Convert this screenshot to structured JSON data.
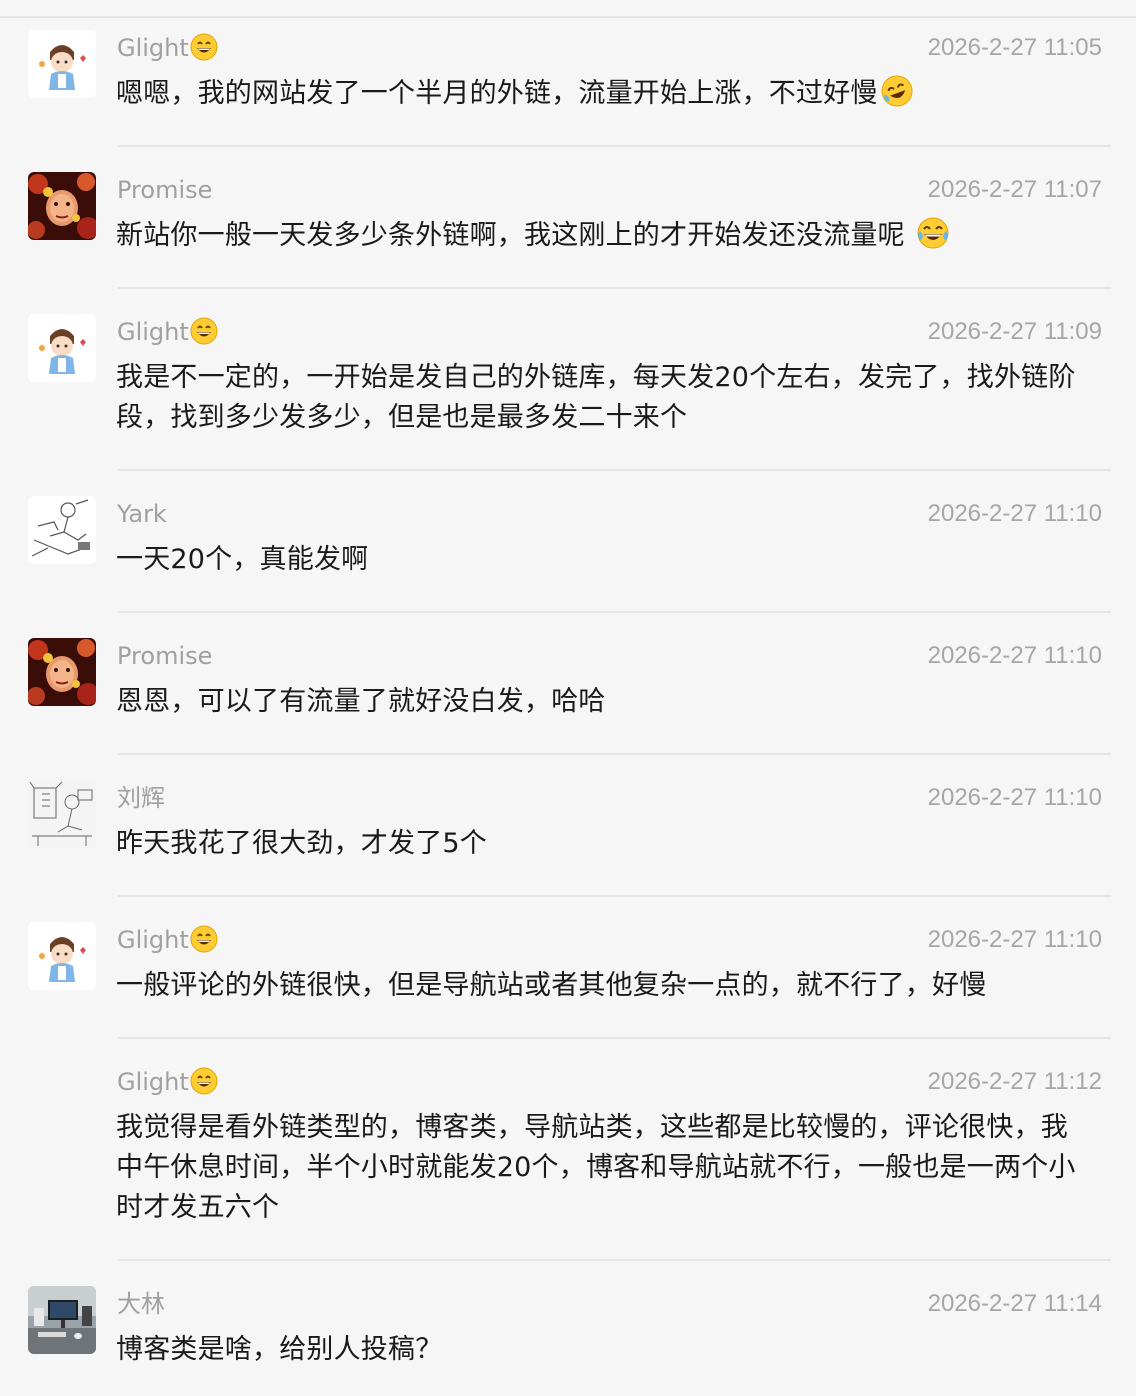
{
  "messages": [
    {
      "name": "Glight",
      "name_emoji": "grinning",
      "avatar": "cartoon-boy-avatar",
      "time": "2026-2-27 11:05",
      "lines": [
        "嗯嗯，我的网站发了一个半月的外链，流量开始上涨，不过好慢"
      ],
      "trailing_emoji": "crying-laughing-tilted"
    },
    {
      "name": "Promise",
      "avatar": "red-floral-face-avatar",
      "time": "2026-2-27 11:07",
      "lines": [
        "新站你一般一天发多少条外链啊，我这刚上的才开始发还没流量呢 "
      ],
      "trailing_emoji": "tears-of-joy"
    },
    {
      "name": "Glight",
      "name_emoji": "grinning",
      "avatar": "cartoon-boy-avatar",
      "time": "2026-2-27 11:09",
      "lines": [
        "我是不一定的，一开始是发自己的外链库，每天发20个左右，发完了，找外链阶",
        "段，找到多少发多少，但是也是最多发二十来个"
      ]
    },
    {
      "name": "Yark",
      "avatar": "sketch-drawing-avatar",
      "time": "2026-2-27 11:10",
      "lines": [
        "一天20个，真能发啊"
      ]
    },
    {
      "name": "Promise",
      "avatar": "red-floral-face-avatar",
      "time": "2026-2-27 11:10",
      "lines": [
        "恩恩，可以了有流量了就好没白发，哈哈"
      ]
    },
    {
      "name": "刘辉",
      "avatar": "sketch-room-avatar",
      "time": "2026-2-27 11:10",
      "lines": [
        "昨天我花了很大劲，才发了5个"
      ]
    },
    {
      "name": "Glight",
      "name_emoji": "grinning",
      "avatar": "cartoon-boy-avatar",
      "time": "2026-2-27 11:10",
      "lines": [
        "一般评论的外链很快，但是导航站或者其他复杂一点的，就不行了，好慢"
      ]
    },
    {
      "name": "Glight",
      "name_emoji": "grinning",
      "time": "2026-2-27 11:12",
      "lines": [
        "我觉得是看外链类型的，博客类，导航站类，这些都是比较慢的，评论很快，我",
        "中午休息时间，半个小时就能发20个，博客和导航站就不行，一般也是一两个小",
        "时才发五六个"
      ]
    },
    {
      "name": "大林",
      "avatar": "desk-monitor-photo-avatar",
      "time": "2026-2-27 11:14",
      "lines": [
        "博客类是啥，给别人投稿？"
      ]
    }
  ],
  "colors": {
    "background": "#f6f6f6",
    "name": "#a0a0a0",
    "time": "#a6a6a6",
    "text": "#1a1a1a",
    "divider": "#e5e5e5"
  }
}
